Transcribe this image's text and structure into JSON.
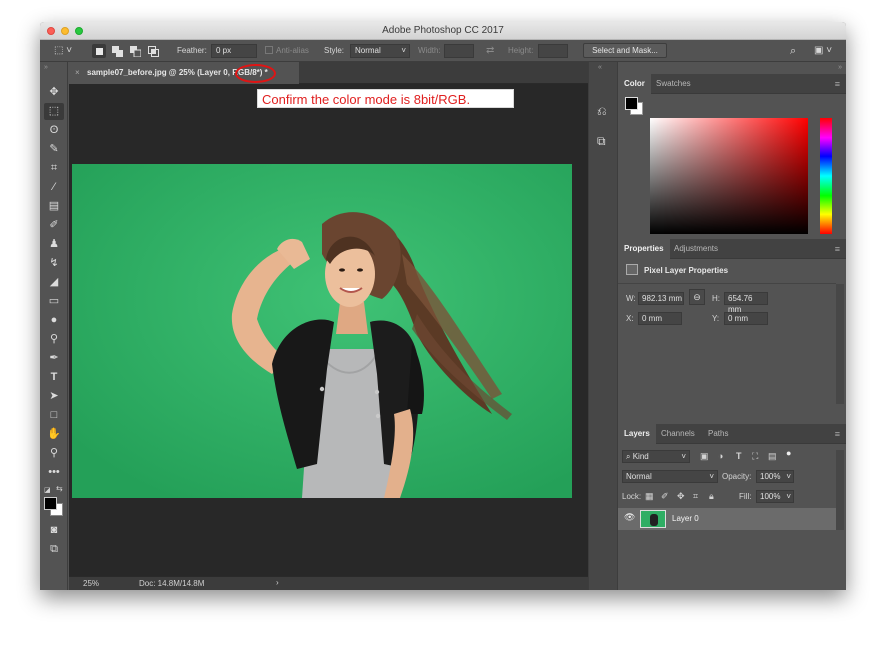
{
  "window": {
    "title": "Adobe Photoshop CC 2017"
  },
  "options_bar": {
    "feather_label": "Feather:",
    "feather_value": "0 px",
    "antialias_label": "Anti-alias",
    "style_label": "Style:",
    "style_value": "Normal",
    "width_label": "Width:",
    "height_label": "Height:",
    "select_mask_label": "Select and Mask..."
  },
  "document": {
    "tab_name": "sample07_before.jpg @ 25% (Layer 0, ",
    "tab_mode": "RGB/8*",
    "tab_suffix": ") *",
    "zoom": "25%",
    "doc_size": "Doc: 14.8M/14.8M"
  },
  "annotation": {
    "text": "Confirm the color mode is 8bit/RGB."
  },
  "color_panel": {
    "tabs": [
      "Color",
      "Swatches"
    ]
  },
  "properties_panel": {
    "tabs": [
      "Properties",
      "Adjustments"
    ],
    "header": "Pixel Layer Properties",
    "w_label": "W:",
    "w_value": "982.13 mm",
    "h_label": "H:",
    "h_value": "654.76 mm",
    "x_label": "X:",
    "x_value": "0 mm",
    "y_label": "Y:",
    "y_value": "0 mm"
  },
  "layers_panel": {
    "tabs": [
      "Layers",
      "Channels",
      "Paths"
    ],
    "filter_value": "Kind",
    "blend_mode": "Normal",
    "opacity_label": "Opacity:",
    "opacity_value": "100%",
    "lock_label": "Lock:",
    "fill_label": "Fill:",
    "fill_value": "100%",
    "layer_name": "Layer 0"
  },
  "colors": {
    "canvas_green": "#2fae64",
    "annotation_red": "#e01f1f",
    "ui_bg": "#535353"
  }
}
